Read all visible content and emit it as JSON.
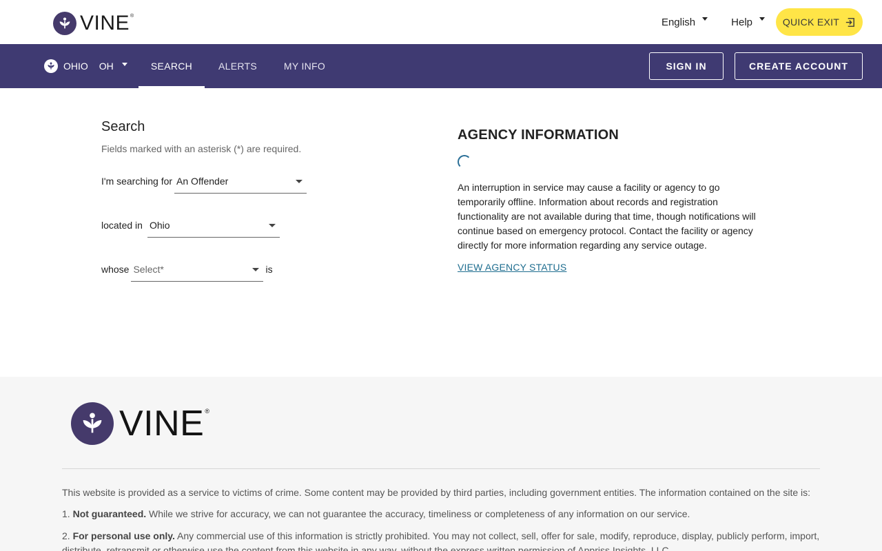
{
  "header": {
    "brand": "VINE",
    "brand_reg": "®",
    "language": "English",
    "help": "Help",
    "quick_exit": "QUICK EXIT",
    "colors": {
      "brand_purple": "#453a6b",
      "quick_exit_bg": "#ffe547"
    }
  },
  "nav": {
    "state_name": "OHIO",
    "state_abbr": "OH",
    "tabs": [
      "SEARCH",
      "ALERTS",
      "MY INFO"
    ],
    "active_tab": "SEARCH",
    "sign_in": "SIGN IN",
    "create_account": "CREATE ACCOUNT",
    "colors": {
      "bar": "#3f3a72"
    }
  },
  "search": {
    "title": "Search",
    "required_note": "Fields marked with an asterisk (*) are required.",
    "searching_for_label": "I'm searching for",
    "searching_for_value": "An Offender",
    "located_in_label": "located in",
    "located_in_value": "Ohio",
    "whose_label": "whose",
    "whose_placeholder": "Select*",
    "is_label": "is"
  },
  "agency": {
    "title": "AGENCY INFORMATION",
    "text": "An interruption in service may cause a facility or agency to go temporarily offline. Information about records and registration functionality are not available during that time, though notifications will continue based on emergency protocol. Contact the facility or agency directly for more information regarding any service outage.",
    "link": "VIEW AGENCY STATUS"
  },
  "footer": {
    "brand": "VINE",
    "intro": "This website is provided as a service to victims of crime. Some content may be provided by third parties, including government entities. The information contained on the site is:",
    "item1_num": "1.",
    "item1_bold": "Not guaranteed.",
    "item1_text": " While we strive for accuracy, we can not guarantee the accuracy, timeliness or completeness of any information on our service.",
    "item2_num": "2.",
    "item2_bold": "For personal use only.",
    "item2_text": " Any commercial use of this information is strictly prohibited. You may not collect, sell, offer for sale, modify, reproduce, display, publicly perform, import, distribute, retransmit or otherwise use the content from this website in any way, without the express written permission of Appriss Insights, LLC."
  }
}
